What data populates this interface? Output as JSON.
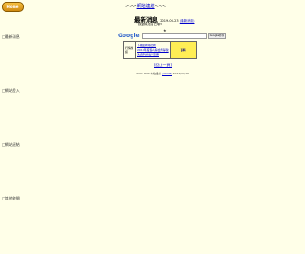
{
  "nav": {
    "home_label": "Home"
  },
  "header": {
    "title_prefix": ">>>",
    "title": "網站連結",
    "title_suffix": "<<<"
  },
  "news": {
    "title": "最新消息",
    "date": "2019-06-23",
    "date_link": "(最新消息)",
    "subheading": "按鍵無法自己聊?",
    "star": "★"
  },
  "search": {
    "logo": "Google",
    "input_value": "",
    "button_label": "Google搜尋"
  },
  "promo": {
    "label": "行情快訊",
    "links": [
      "下載最新版更新",
      "2019年度個人綜合所得稅",
      "免費申請電子發票"
    ],
    "badge": "百科"
  },
  "top_link": "[回上一頁]",
  "footer": {
    "text": "Short Bus 本站設計",
    "link": "(Home)",
    "suffix": "2021/02/16"
  },
  "sidebar": {
    "items": [
      "□最新消息",
      "□網站登入",
      "□網站連結",
      "□其他時間"
    ]
  }
}
